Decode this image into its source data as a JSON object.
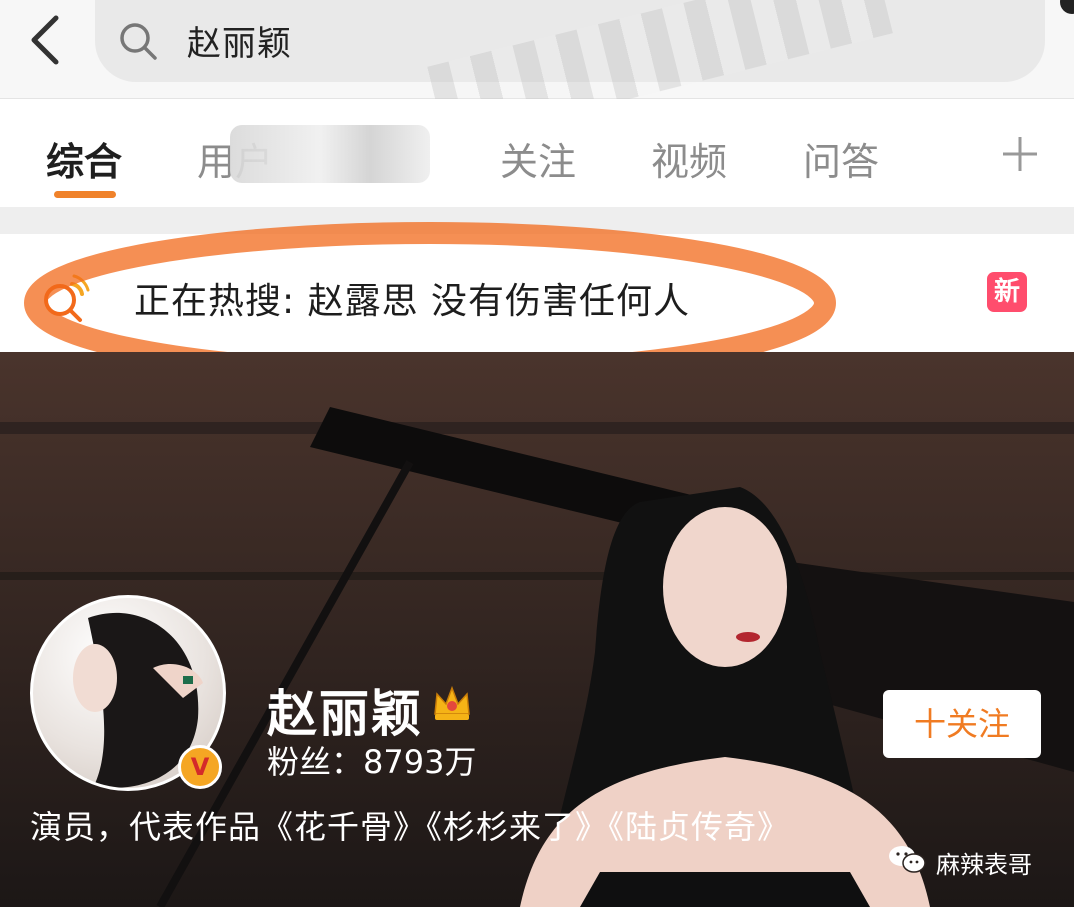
{
  "search": {
    "query": "赵丽颖"
  },
  "tabs": {
    "items": [
      {
        "label": "综合",
        "active": true
      },
      {
        "label": "用户"
      },
      {
        "label": "关注"
      },
      {
        "label": "视频"
      },
      {
        "label": "问答"
      }
    ]
  },
  "hot_search": {
    "text": "正在热搜: 赵露思 没有伤害任何人",
    "badge": "新",
    "icon": "hot-search-icon"
  },
  "profile": {
    "name": "赵丽颖",
    "fans": "粉丝：8793万",
    "bio": "演员，代表作品《花千骨》《杉杉来了》《陆贞传奇》",
    "follow_label": "十关注",
    "verified_mark": "V"
  },
  "watermark": {
    "text": "麻辣表哥"
  },
  "colors": {
    "accent": "#f0822a",
    "badge": "#ff4d6d",
    "annotation": "#f26a1b"
  }
}
